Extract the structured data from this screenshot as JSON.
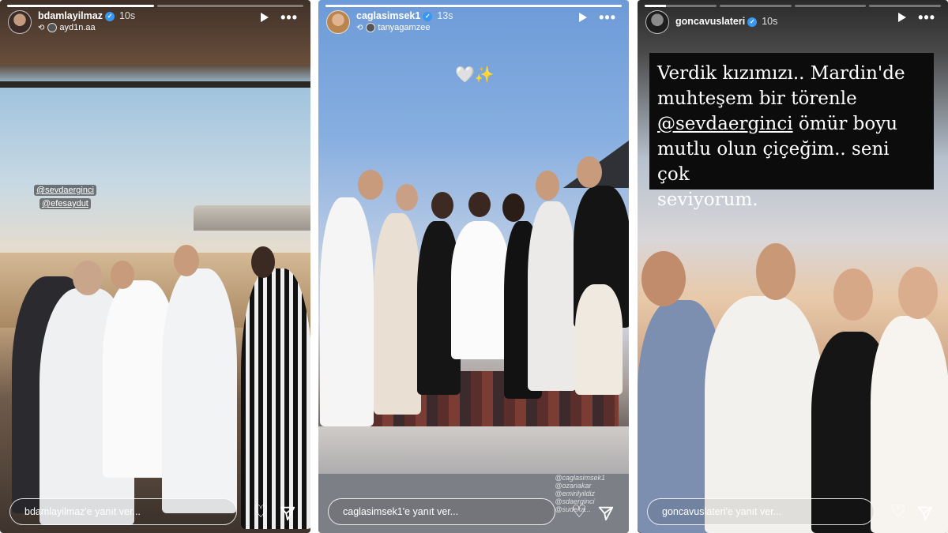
{
  "stories": [
    {
      "username": "bdamlayilmaz",
      "time": "10s",
      "repost_from": "ayd1n.aa",
      "tags": [
        "@sevdaerginci",
        "@efesaydut"
      ],
      "reply_placeholder": "bdamlayilmaz'e yanıt ver...",
      "progress": [
        1.0,
        0.0
      ],
      "icons": {
        "verified": "verified-icon",
        "play": "play-icon",
        "more": "more-options-icon",
        "like": "heart-icon",
        "send": "send-icon"
      }
    },
    {
      "username": "caglasimsek1",
      "time": "13s",
      "repost_from": "tanyagamzee",
      "sticker": "🤍✨",
      "caption_tags": [
        "@caglasimsek1",
        "@ozanakar",
        "@emirilyildiz",
        "@sdaerginci",
        "@sudeka..."
      ],
      "reply_placeholder": "caglasimsek1'e yanıt ver...",
      "progress": [
        1.0
      ],
      "icons": {
        "verified": "verified-icon",
        "play": "play-icon",
        "more": "more-options-icon",
        "like": "heart-icon",
        "send": "send-icon"
      }
    },
    {
      "username": "goncavuslateri",
      "time": "10s",
      "text_line1": "Verdik kızımızı.. Mardin'de",
      "text_line2": "muhteşem bir törenle",
      "mention": "@sevdaerginci",
      "text_line3_rest": " ömür boyu",
      "text_line4": "mutlu olun çiçeğim.. seni çok",
      "text_line5": "seviyorum.",
      "reply_placeholder": "goncavuslateri'e yanıt ver...",
      "progress": [
        0.3,
        0.0,
        0.0,
        0.0
      ],
      "icons": {
        "verified": "verified-icon",
        "play": "play-icon",
        "more": "more-options-icon",
        "like": "heart-icon",
        "send": "send-icon"
      }
    }
  ]
}
